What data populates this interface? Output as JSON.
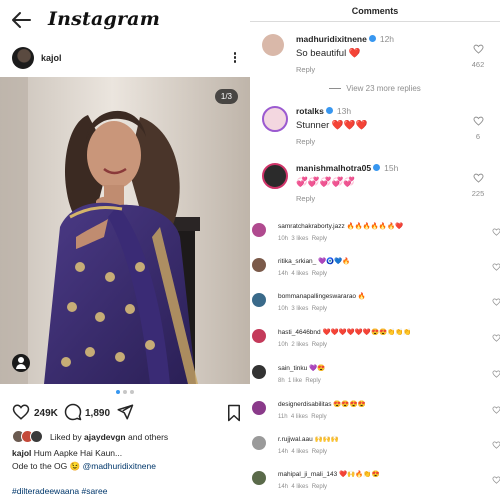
{
  "header": {
    "logo": "Instagram"
  },
  "post": {
    "username": "kajol",
    "page_indicator": "1/3",
    "likes": "249K",
    "comments_count": "1,890",
    "liked_by_prefix": "Liked by",
    "liked_by_user": "ajaydevgn",
    "liked_by_suffix": "and others",
    "caption_user": "kajol",
    "caption_text": "Hum Aapke Hai Kaun...",
    "caption_line2": "Ode to the OG 😉",
    "caption_mention": "@madhuridixitnene",
    "hashtags": "#dilteradeewaana #saree"
  },
  "comments_panel": {
    "title": "Comments",
    "view_more": "View 23 more replies",
    "main_comments": [
      {
        "username": "madhuridixitnene",
        "time": "12h",
        "text": "So beautiful ❤️",
        "reply": "Reply",
        "likes": "462",
        "verified": true,
        "avatar_color": "#d9b8a9"
      },
      {
        "username": "rotalks",
        "time": "13h",
        "text": "Stunner ❤️❤️❤️",
        "reply": "Reply",
        "likes": "6",
        "verified": true,
        "avatar_color": "#6c4aa8"
      },
      {
        "username": "manishmalhotra05",
        "time": "15h",
        "text": "💞💞💞💞💞",
        "reply": "Reply",
        "likes": "225",
        "verified": true,
        "avatar_color": "#2b2b2b"
      }
    ],
    "small_comments": [
      {
        "username": "samratchakraborty.jazz",
        "text": "🔥🔥🔥🔥🔥🔥❤️",
        "time": "10h",
        "likes": "3 likes",
        "reply": "Reply",
        "avatar_color": "#b04a8f"
      },
      {
        "username": "ritika_srkian_",
        "text": "💜🧿💙🔥",
        "time": "14h",
        "likes": "4 likes",
        "reply": "Reply",
        "avatar_color": "#7b5a4a"
      },
      {
        "username": "bommanapallingeswararao",
        "text": "🔥",
        "time": "10h",
        "likes": "3 likes",
        "reply": "Reply",
        "avatar_color": "#3a6a8a"
      },
      {
        "username": "hasti_4646bnd",
        "text": "❤️❤️❤️❤️❤️❤️😍😍👏👏👏",
        "time": "10h",
        "likes": "2 likes",
        "reply": "Reply",
        "avatar_color": "#c43a5a"
      },
      {
        "username": "sain_tinku",
        "text": "💜😍",
        "time": "8h",
        "likes": "1 like",
        "reply": "Reply",
        "avatar_color": "#333333"
      },
      {
        "username": "designerdisabilitas",
        "text": "😍😍😍😍",
        "time": "11h",
        "likes": "4 likes",
        "reply": "Reply",
        "avatar_color": "#8a3a8a"
      },
      {
        "username": "r.rujjwal.aau",
        "text": "🙌🙌🙌",
        "time": "14h",
        "likes": "4 likes",
        "reply": "Reply",
        "avatar_color": "#9a9a9a"
      },
      {
        "username": "mahipal_ji_mali_143",
        "text": "❤️🙌🔥👏😍",
        "time": "14h",
        "likes": "4 likes",
        "reply": "Reply",
        "avatar_color": "#5a6a4a"
      }
    ]
  },
  "colors": {
    "accent": "#3797f0",
    "link": "#00376b",
    "muted": "#8e8e8e",
    "saree": "#3a2a6e"
  }
}
